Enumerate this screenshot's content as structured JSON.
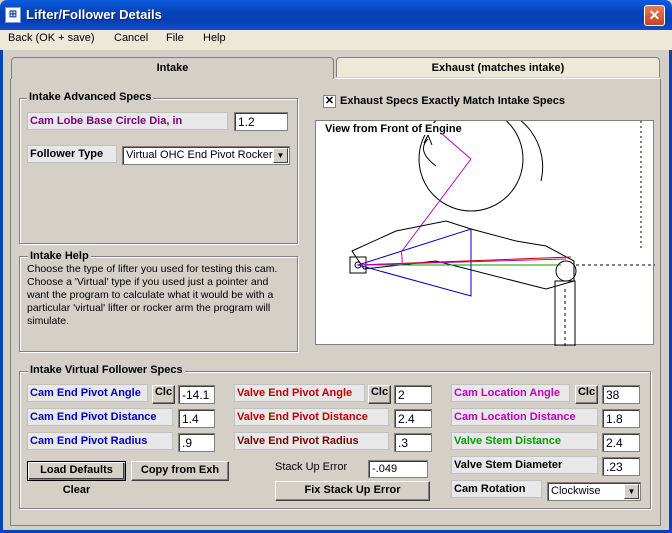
{
  "window": {
    "title": "Lifter/Follower Details",
    "close_glyph": "✕",
    "icon_glyph": "⊞"
  },
  "menu": [
    "Back (OK + save)",
    "Cancel",
    "File",
    "Help"
  ],
  "tabs": {
    "intake": "Intake",
    "exhaust": "Exhaust (matches intake)"
  },
  "advanced": {
    "title": "Intake Advanced Specs",
    "base_circle_label": "Cam Lobe Base Circle Dia, in",
    "base_circle_value": "1.2",
    "follower_type_label": "Follower Type",
    "follower_type_value": "Virtual OHC End Pivot Rocker",
    "combo_arrow": "▼"
  },
  "help": {
    "title": "Intake Help",
    "text": "Choose the type of lifter you used for testing this cam. Choose a 'Virtual' type if you used just a pointer and want the program to calculate what it would be with a particular 'virtual' lifter or rocker arm the program will simulate."
  },
  "match": {
    "checked_glyph": "✕",
    "label": "Exhaust Specs Exactly Match Intake Specs"
  },
  "diagram": {
    "caption": "View from Front of Engine"
  },
  "virtual": {
    "title": "Intake Virtual Follower Specs",
    "clc": "Clc",
    "cam_end_pivot_angle_label": "Cam End Pivot Angle",
    "cam_end_pivot_angle_value": "-14.1",
    "cam_end_pivot_distance_label": "Cam End Pivot Distance",
    "cam_end_pivot_distance_value": "1.4",
    "cam_end_pivot_radius_label": "Cam End Pivot Radius",
    "cam_end_pivot_radius_value": ".9",
    "valve_end_pivot_angle_label": "Valve End Pivot Angle",
    "valve_end_pivot_angle_value": "2",
    "valve_end_pivot_distance_label": "Valve End Pivot Distance",
    "valve_end_pivot_distance_value": "2.4",
    "valve_end_pivot_radius_label": "Valve End Pivot Radius",
    "valve_end_pivot_radius_value": ".3",
    "cam_location_angle_label": "Cam Location Angle",
    "cam_location_angle_value": "38",
    "cam_location_distance_label": "Cam Location Distance",
    "cam_location_distance_value": "1.8",
    "valve_stem_distance_label": "Valve Stem Distance",
    "valve_stem_distance_value": "2.4",
    "valve_stem_diameter_label": "Valve Stem Diameter",
    "valve_stem_diameter_value": ".23",
    "cam_rotation_label": "Cam Rotation",
    "cam_rotation_value": "Clockwise",
    "stack_up_error_label": "Stack Up Error",
    "stack_up_error_value": "-.049",
    "load_defaults": "Load Defaults",
    "copy_from_exh": "Copy from Exh",
    "clear": "Clear",
    "fix_stack_up_error": "Fix Stack Up Error"
  }
}
